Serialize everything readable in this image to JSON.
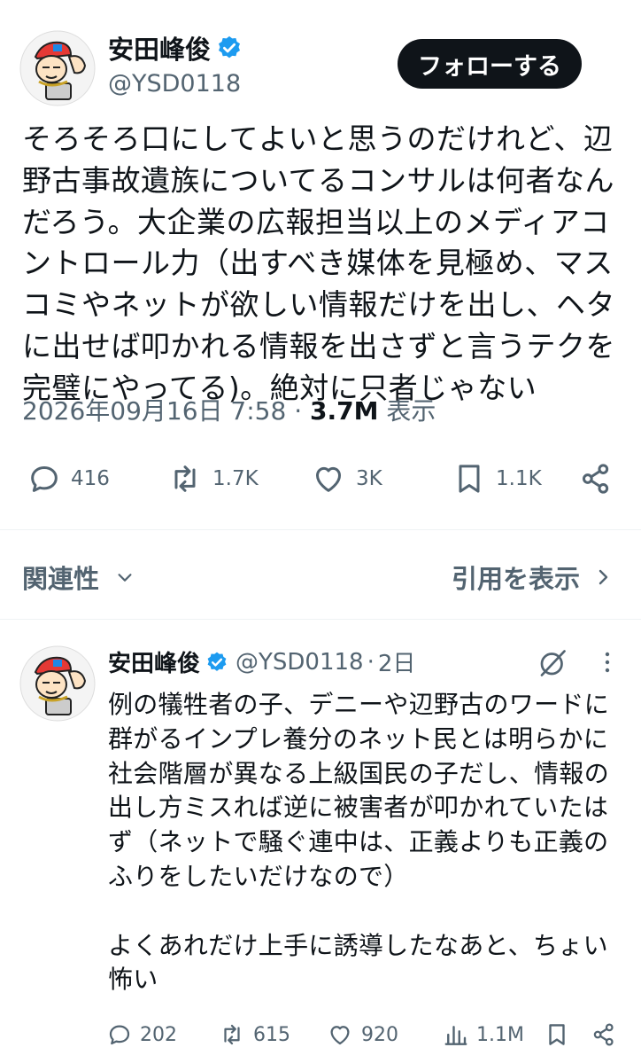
{
  "main_tweet": {
    "author_name": "安田峰俊",
    "handle": "@YSD0118",
    "follow_label": "フォローする",
    "text": "そろそろ口にしてよいと思うのだけれど、辺野古事故遺族についてるコンサルは何者なんだろう。大企業の広報担当以上のメディアコントロール力（出すべき媒体を見極め、マスコミやネットが欲しい情報だけを出し、ヘタに出せば叩かれる情報を出さずと言うテクを完璧にやってる)。絶対に只者じゃない",
    "timestamp": "2026年09月16日 7:58",
    "separator": "·",
    "views": "3.7M",
    "views_label": "表示",
    "actions": {
      "replies": "416",
      "reposts": "1.7K",
      "likes": "3K",
      "bookmarks": "1.1K"
    },
    "icons": {
      "verified": "verified-badge-icon",
      "reply": "reply-icon",
      "repost": "repost-icon",
      "like": "heart-icon",
      "bookmark": "bookmark-icon",
      "share": "share-icon"
    }
  },
  "sort_bar": {
    "sort_label": "関連性",
    "quotes_label": "引用を表示"
  },
  "reply": {
    "author_name": "安田峰俊",
    "handle": "@YSD0118",
    "separator": "·",
    "time": "2日",
    "text": "例の犠牲者の子、デニーや辺野古のワードに群がるインプレ養分のネット民とは明らかに社会階層が異なる上級国民の子だし、情報の出し方ミスれば逆に被害者が叩かれていたはず（ネットで騒ぐ連中は、正義よりも正義のふりをしたいだけなので）\n\nよくあれだけ上手に誘導したなあと、ちょい怖い",
    "actions": {
      "replies": "202",
      "reposts": "615",
      "likes": "920",
      "views": "1.1M"
    }
  },
  "colors": {
    "text": "#0f1419",
    "secondary": "#536471",
    "verified": "#1d9bf0",
    "button_bg": "#0f1419",
    "divider": "#eff3f4"
  }
}
